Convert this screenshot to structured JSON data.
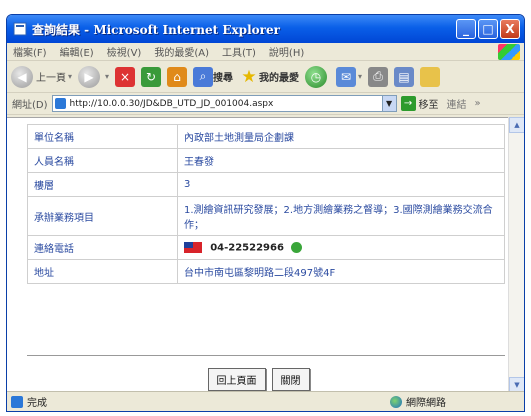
{
  "window": {
    "title": "查詢結果 - Microsoft Internet Explorer",
    "minimize": "_",
    "maximize": "□",
    "close": "X"
  },
  "menu": [
    "檔案(F)",
    "編輯(E)",
    "檢視(V)",
    "我的最愛(A)",
    "工具(T)",
    "說明(H)"
  ],
  "toolbar": {
    "back": "上一頁",
    "search": "搜尋",
    "favorites": "我的最愛"
  },
  "address": {
    "label": "網址(D)",
    "url": "http://10.0.0.30/JD&DB_UTD_JD_001004.aspx",
    "go": "移至",
    "links": "連結"
  },
  "details": [
    {
      "label": "單位名稱",
      "value": "內政部土地測量局企劃課"
    },
    {
      "label": "人員名稱",
      "value": "王春發"
    },
    {
      "label": "樓層",
      "value": "3"
    },
    {
      "label": "承辦業務項目",
      "value": "1.測繪資訊研究發展；2.地方測繪業務之督導；3.國際測繪業務交流合作；"
    },
    {
      "label": "連絡電話",
      "value": "04-22522966"
    },
    {
      "label": "地址",
      "value": "台中市南屯區黎明路二段497號4F"
    }
  ],
  "buttons": {
    "back_to_top": "回上頁面",
    "close": "關閉"
  },
  "status": {
    "left": "完成",
    "zone": "網際網路"
  }
}
